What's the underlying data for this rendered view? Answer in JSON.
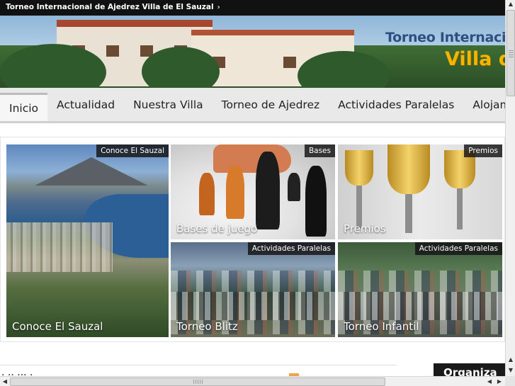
{
  "topbar": {
    "title": "Torneo Internacional de Ajedrez Villa de El Sauzal",
    "arrow": "›"
  },
  "banner": {
    "line1": "Torneo Internacior",
    "line2": "Villa de"
  },
  "nav": {
    "items": [
      {
        "label": "Inicio",
        "active": true
      },
      {
        "label": "Actualidad"
      },
      {
        "label": "Nuestra Villa"
      },
      {
        "label": "Torneo de Ajedrez"
      },
      {
        "label": "Actividades Paralelas"
      },
      {
        "label": "Alojami"
      }
    ]
  },
  "gallery": {
    "tiles": [
      {
        "caption": "Conoce El Sauzal",
        "tag": "Conoce El Sauzal"
      },
      {
        "caption": "Bases de juego",
        "tag": "Bases"
      },
      {
        "caption": "Premios",
        "tag": "Premios"
      },
      {
        "caption": "Torneo Blitz",
        "tag": "Actividades Paralelas"
      },
      {
        "caption": "Torneo Infantil",
        "tag": "Actividades Paralelas"
      }
    ]
  },
  "below": {
    "left_text": "· ·· ··· ·",
    "right_tab": "Organiza"
  },
  "colors": {
    "topbar_bg": "#111111",
    "nav_bg": "#e9e9e9",
    "banner_yellow": "#f2b600",
    "banner_blue": "#2e4f82"
  }
}
